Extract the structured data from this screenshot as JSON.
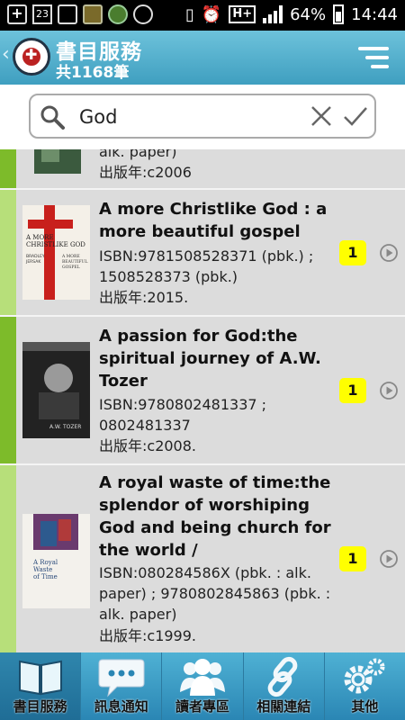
{
  "status_bar": {
    "calendar_day": "23",
    "network": "H+",
    "battery": "64%",
    "time": "14:44"
  },
  "header": {
    "back_icon": "chevron-left-icon",
    "title": "書目服務",
    "count": "共1168筆",
    "menu_icon": "hamburger-menu-icon"
  },
  "search": {
    "value": "God",
    "search_icon": "magnifier-icon",
    "clear_icon": "close-x-icon",
    "confirm_icon": "check-icon"
  },
  "results": [
    {
      "title": "",
      "meta_lines": [
        "alk. paper)",
        "出版年:c2006"
      ],
      "bar_color": "#7dbb2a",
      "badge": ""
    },
    {
      "title": "A more Christlike God  : a more beautiful gospel",
      "meta_lines": [
        "ISBN:9781508528371 (pbk.) ; 1508528373 (pbk.)",
        "出版年:2015."
      ],
      "bar_color": "#b7df7a",
      "badge": "1",
      "cover_text": "A MORE CHRISTLIKE GOD"
    },
    {
      "title": "A passion for God:the spiritual journey of A.W. Tozer",
      "meta_lines": [
        "ISBN:9780802481337 ; 0802481337",
        "出版年:c2008."
      ],
      "bar_color": "#7dbb2a",
      "badge": "1",
      "cover_text": "A.W. TOZER"
    },
    {
      "title": "A royal waste of time:the splendor of worshiping God and being church for the world /",
      "meta_lines": [
        "ISBN:080284586X (pbk. : alk. paper) ; 9780802845863 (pbk. : alk. paper)",
        "出版年:c1999."
      ],
      "bar_color": "#b7df7a",
      "badge": "1",
      "cover_text": "A Royal Waste of Time"
    }
  ],
  "tabs": [
    {
      "label": "書目服務",
      "icon": "book-icon",
      "active": true
    },
    {
      "label": "訊息通知",
      "icon": "chat-bubble-icon",
      "active": false
    },
    {
      "label": "讀者專區",
      "icon": "people-icon",
      "active": false
    },
    {
      "label": "相關連結",
      "icon": "link-icon",
      "active": false
    },
    {
      "label": "其他",
      "icon": "gear-icon",
      "active": false
    }
  ]
}
